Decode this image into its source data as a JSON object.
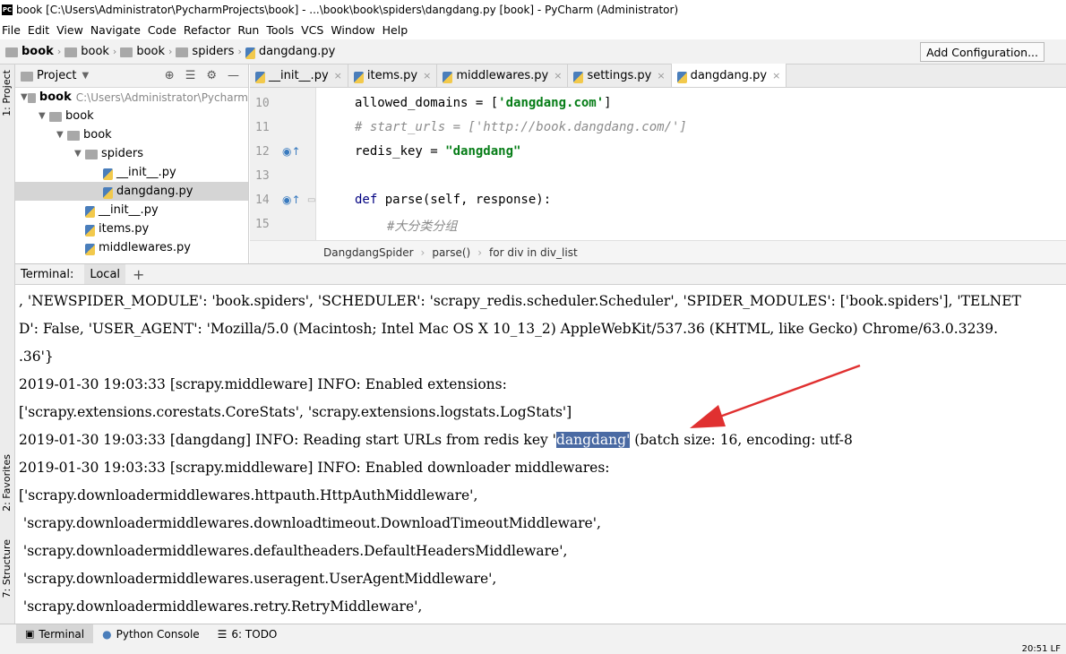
{
  "title": "book [C:\\Users\\Administrator\\PycharmProjects\\book] - ...\\book\\book\\spiders\\dangdang.py [book] - PyCharm (Administrator)",
  "app_icon_label": "PC",
  "menu": [
    "File",
    "Edit",
    "View",
    "Navigate",
    "Code",
    "Refactor",
    "Run",
    "Tools",
    "VCS",
    "Window",
    "Help"
  ],
  "breadcrumbs": [
    "book",
    "book",
    "book",
    "spiders",
    "dangdang.py"
  ],
  "add_configuration": "Add Configuration...",
  "left_tabs": {
    "project": "1: Project",
    "favorites": "2: Favorites",
    "structure": "7: Structure"
  },
  "project_panel": {
    "label": "Project",
    "tree": [
      {
        "name": "book",
        "hint": "C:\\Users\\Administrator\\Pycharm",
        "indent": 0,
        "type": "folder",
        "expanded": true,
        "bold": true
      },
      {
        "name": "book",
        "hint": "",
        "indent": 1,
        "type": "folder",
        "expanded": true,
        "bold": false
      },
      {
        "name": "book",
        "hint": "",
        "indent": 2,
        "type": "folder",
        "expanded": true,
        "bold": false
      },
      {
        "name": "spiders",
        "hint": "",
        "indent": 3,
        "type": "folder",
        "expanded": true,
        "bold": false
      },
      {
        "name": "__init__.py",
        "hint": "",
        "indent": 4,
        "type": "py",
        "expanded": false,
        "bold": false
      },
      {
        "name": "dangdang.py",
        "hint": "",
        "indent": 4,
        "type": "py",
        "expanded": false,
        "bold": false,
        "selected": true
      },
      {
        "name": "__init__.py",
        "hint": "",
        "indent": 3,
        "type": "py",
        "expanded": false,
        "bold": false
      },
      {
        "name": "items.py",
        "hint": "",
        "indent": 3,
        "type": "py",
        "expanded": false,
        "bold": false
      },
      {
        "name": "middlewares.py",
        "hint": "",
        "indent": 3,
        "type": "py",
        "expanded": false,
        "bold": false
      }
    ]
  },
  "editor_tabs": [
    {
      "label": "__init__.py",
      "active": false
    },
    {
      "label": "items.py",
      "active": false
    },
    {
      "label": "middlewares.py",
      "active": false
    },
    {
      "label": "settings.py",
      "active": false
    },
    {
      "label": "dangdang.py",
      "active": true
    }
  ],
  "code_lines": [
    {
      "num": "10",
      "text_pre": "allowed_domains = [",
      "str": "'dangdang.com'",
      "text_post": "]"
    },
    {
      "num": "11",
      "comment": "# start_urls = ['http://book.dangdang.com/']"
    },
    {
      "num": "12",
      "text_pre": "redis_key = ",
      "str": "\"dangdang\"",
      "text_post": ""
    },
    {
      "num": "13",
      "text_pre": "",
      "str": "",
      "text_post": ""
    },
    {
      "num": "14",
      "kw": "def ",
      "text_pre": "parse(self, response):",
      "str": "",
      "text_post": ""
    },
    {
      "num": "15",
      "comment": "#大分类分组"
    }
  ],
  "code_breadcrumb": [
    "DangdangSpider",
    "parse()",
    "for div in div_list"
  ],
  "terminal": {
    "label": "Terminal:",
    "tab": "Local",
    "add": "+",
    "lines": [
      ", 'NEWSPIDER_MODULE': 'book.spiders', 'SCHEDULER': 'scrapy_redis.scheduler.Scheduler', 'SPIDER_MODULES': ['book.spiders'], 'TELNET",
      "D': False, 'USER_AGENT': 'Mozilla/5.0 (Macintosh; Intel Mac OS X 10_13_2) AppleWebKit/537.36 (KHTML, like Gecko) Chrome/63.0.3239.",
      ".36'}",
      "2019-01-30 19:03:33 [scrapy.middleware] INFO: Enabled extensions:",
      "['scrapy.extensions.corestats.CoreStats', 'scrapy.extensions.logstats.LogStats']",
      "2019-01-30 19:03:33 [scrapy.middleware] INFO: Enabled downloader middlewares:",
      "['scrapy.downloadermiddlewares.httpauth.HttpAuthMiddleware',",
      " 'scrapy.downloadermiddlewares.downloadtimeout.DownloadTimeoutMiddleware',",
      " 'scrapy.downloadermiddlewares.defaultheaders.DefaultHeadersMiddleware',",
      " 'scrapy.downloadermiddlewares.useragent.UserAgentMiddleware',",
      " 'scrapy.downloadermiddlewares.retry.RetryMiddleware',"
    ],
    "highlight_line": {
      "pre": "2019-01-30 19:03:33 [dangdang] INFO: Reading start URLs from redis key '",
      "highlight": "dangdang'",
      "post": " (batch size: 16, encoding: utf-8"
    }
  },
  "bottom_tabs": [
    "Terminal",
    "Python Console",
    "6: TODO"
  ],
  "status": "20:51  LF"
}
